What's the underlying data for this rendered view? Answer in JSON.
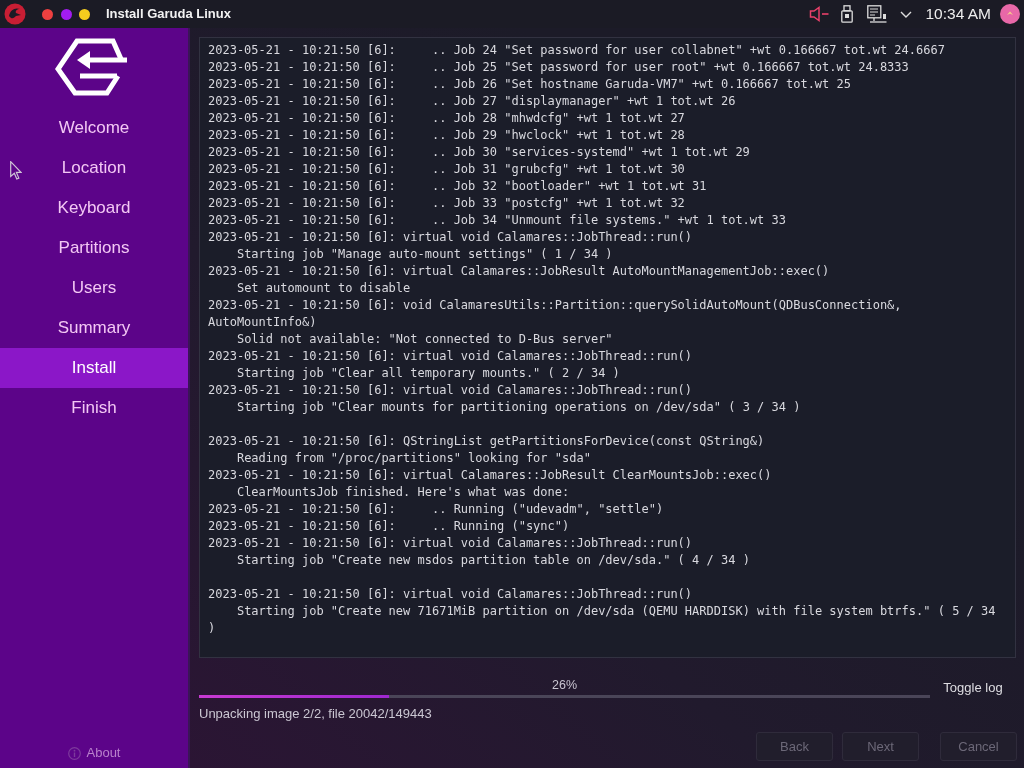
{
  "window": {
    "title": "Install Garuda Linux"
  },
  "tray": {
    "clock": "10:34 AM"
  },
  "sidebar": {
    "items": [
      {
        "label": "Welcome",
        "selected": false
      },
      {
        "label": "Location",
        "selected": false
      },
      {
        "label": "Keyboard",
        "selected": false
      },
      {
        "label": "Partitions",
        "selected": false
      },
      {
        "label": "Users",
        "selected": false
      },
      {
        "label": "Summary",
        "selected": false
      },
      {
        "label": "Install",
        "selected": true
      },
      {
        "label": "Finish",
        "selected": false
      }
    ],
    "about": "About"
  },
  "log": {
    "blocks": [
      {
        "lines": [
          "2023-05-21 - 10:21:50 [6]:     .. Job 24 \"Set password for user collabnet\" +wt 0.166667 tot.wt 24.6667",
          "2023-05-21 - 10:21:50 [6]:     .. Job 25 \"Set password for user root\" +wt 0.166667 tot.wt 24.8333",
          "2023-05-21 - 10:21:50 [6]:     .. Job 26 \"Set hostname Garuda-VM7\" +wt 0.166667 tot.wt 25",
          "2023-05-21 - 10:21:50 [6]:     .. Job 27 \"displaymanager\" +wt 1 tot.wt 26",
          "2023-05-21 - 10:21:50 [6]:     .. Job 28 \"mhwdcfg\" +wt 1 tot.wt 27",
          "2023-05-21 - 10:21:50 [6]:     .. Job 29 \"hwclock\" +wt 1 tot.wt 28",
          "2023-05-21 - 10:21:50 [6]:     .. Job 30 \"services-systemd\" +wt 1 tot.wt 29",
          "2023-05-21 - 10:21:50 [6]:     .. Job 31 \"grubcfg\" +wt 1 tot.wt 30",
          "2023-05-21 - 10:21:50 [6]:     .. Job 32 \"bootloader\" +wt 1 tot.wt 31",
          "2023-05-21 - 10:21:50 [6]:     .. Job 33 \"postcfg\" +wt 1 tot.wt 32",
          "2023-05-21 - 10:21:50 [6]:     .. Job 34 \"Unmount file systems.\" +wt 1 tot.wt 33",
          "2023-05-21 - 10:21:50 [6]: virtual void Calamares::JobThread::run()",
          "    Starting job \"Manage auto-mount settings\" ( 1 / 34 )",
          "2023-05-21 - 10:21:50 [6]: virtual Calamares::JobResult AutoMountManagementJob::exec()",
          "    Set automount to disable",
          "2023-05-21 - 10:21:50 [6]: void CalamaresUtils::Partition::querySolidAutoMount(QDBusConnection&, AutoMountInfo&)",
          "    Solid not available: \"Not connected to D-Bus server\"",
          "2023-05-21 - 10:21:50 [6]: virtual void Calamares::JobThread::run()",
          "    Starting job \"Clear all temporary mounts.\" ( 2 / 34 )",
          "2023-05-21 - 10:21:50 [6]: virtual void Calamares::JobThread::run()",
          "    Starting job \"Clear mounts for partitioning operations on /dev/sda\" ( 3 / 34 )"
        ]
      },
      {
        "lines": [
          "2023-05-21 - 10:21:50 [6]: QStringList getPartitionsForDevice(const QString&)",
          "    Reading from \"/proc/partitions\" looking for \"sda\"",
          "2023-05-21 - 10:21:50 [6]: virtual Calamares::JobResult ClearMountsJob::exec()",
          "    ClearMountsJob finished. Here's what was done:",
          "2023-05-21 - 10:21:50 [6]:     .. Running (\"udevadm\", \"settle\")",
          "2023-05-21 - 10:21:50 [6]:     .. Running (\"sync\")",
          "2023-05-21 - 10:21:50 [6]: virtual void Calamares::JobThread::run()",
          "    Starting job \"Create new msdos partition table on /dev/sda.\" ( 4 / 34 )"
        ]
      },
      {
        "lines": [
          "2023-05-21 - 10:21:50 [6]: virtual void Calamares::JobThread::run()",
          "    Starting job \"Create new 71671MiB partition on /dev/sda (QEMU HARDDISK) with file system btrfs.\" ( 5 / 34 )"
        ]
      }
    ]
  },
  "progress": {
    "label": "26%",
    "level": 0.26,
    "toggle": "Toggle log",
    "status": "Unpacking image 2/2, file 20042/149443"
  },
  "buttons": [
    {
      "label": "Back",
      "disabled": true
    },
    {
      "label": "Next",
      "disabled": true
    },
    {
      "label": "Cancel",
      "disabled": true
    }
  ]
}
